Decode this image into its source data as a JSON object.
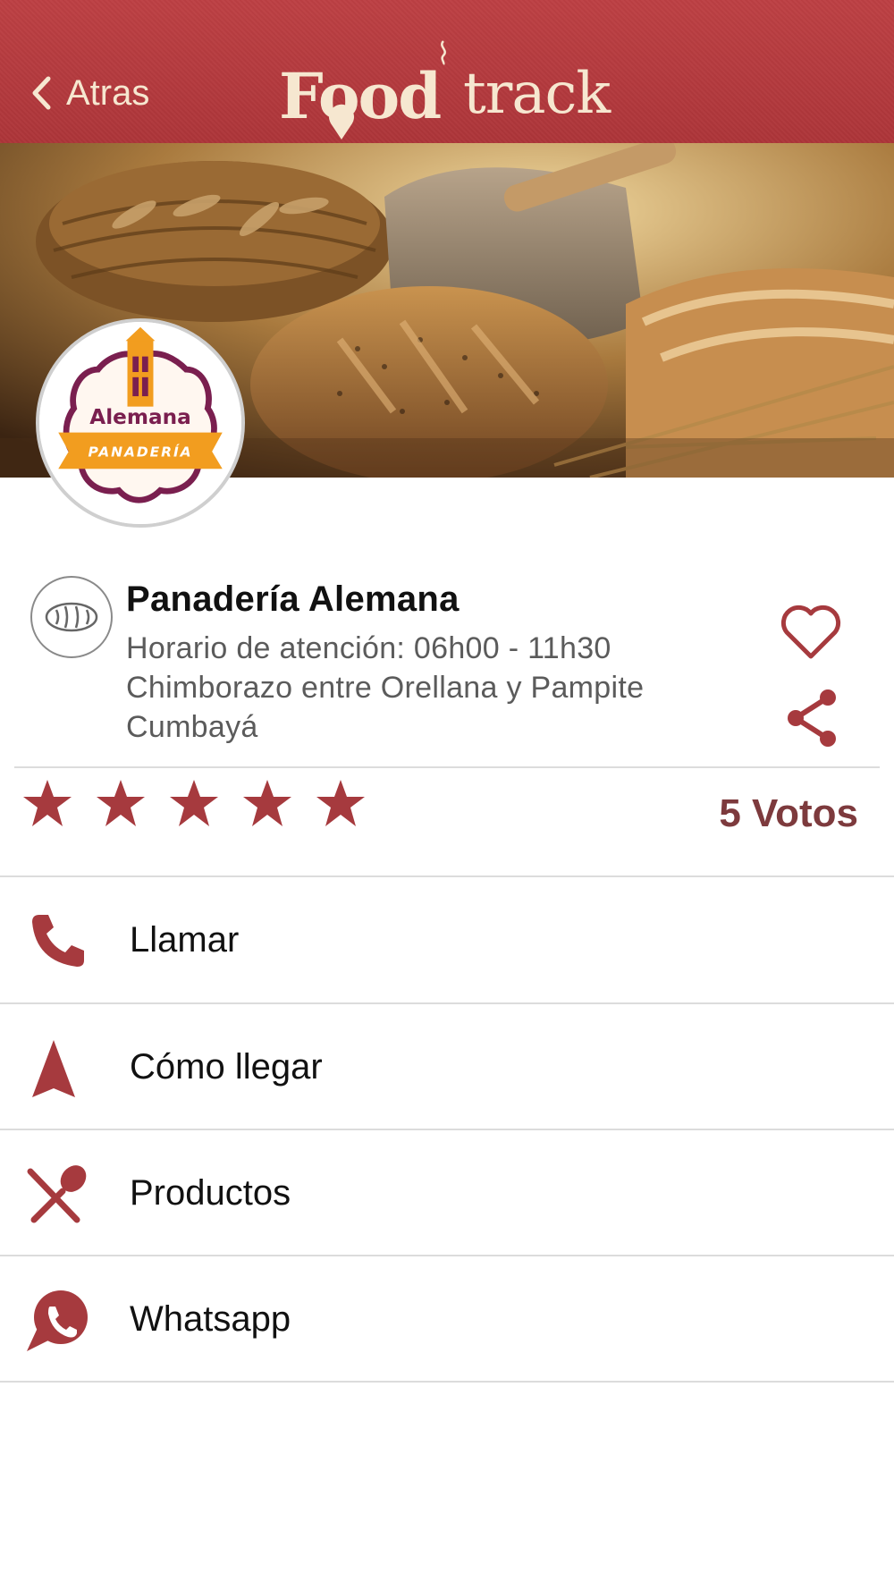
{
  "header": {
    "back_label": "Atras",
    "logo_text_bold": "Food",
    "logo_text_light": "track"
  },
  "store": {
    "logo_name": "Alemana",
    "logo_sub": "PANADERÍA",
    "name": "Panadería Alemana",
    "hours": "Horario de atención: 06h00 - 11h30",
    "address_line1": "Chimborazo entre Orellana y Pampite",
    "address_line2": "Cumbayá"
  },
  "rating": {
    "stars_filled": 5,
    "stars_total": 5,
    "votes_label": "5 Votos"
  },
  "actions": [
    {
      "label": "Llamar",
      "icon": "phone-icon"
    },
    {
      "label": "Cómo llegar",
      "icon": "navigation-icon"
    },
    {
      "label": "Productos",
      "icon": "fork-spoon-icon"
    },
    {
      "label": "Whatsapp",
      "icon": "whatsapp-icon"
    }
  ],
  "colors": {
    "brand_red": "#b83b40",
    "accent_red": "#a63a3e",
    "header_text": "#f6e7d0",
    "votes_text": "#7d3a3d",
    "logo_purple": "#7a1f4f",
    "logo_orange": "#f29d1f"
  }
}
